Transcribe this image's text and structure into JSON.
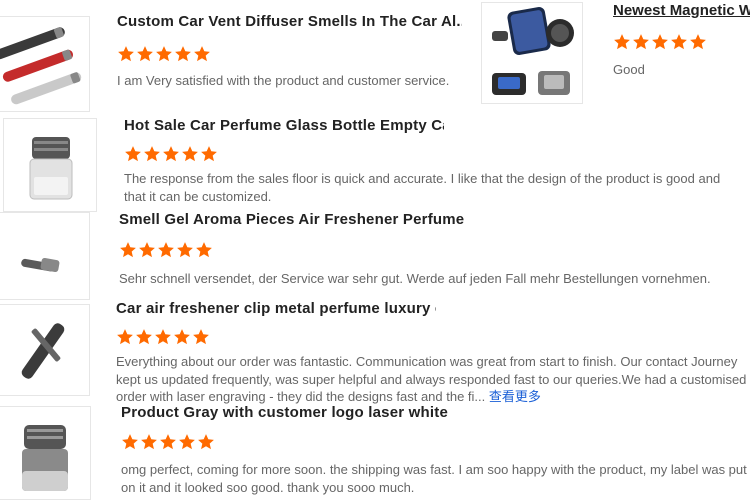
{
  "colors": {
    "star": "#ff6a00",
    "link": "#1a5fd6"
  },
  "products": [
    {
      "title": "Custom Car Vent Diffuser Smells In The Car Al...",
      "rating": 5,
      "review": "I am Very satisfied with the product and customer service.",
      "image": "car-vent-diffuser-sticks"
    },
    {
      "title": "Hot Sale Car Perfume Glass Bottle Empty Car ...",
      "rating": 5,
      "review": "The response from the sales floor is quick and accurate. I like that the design of the product is good and that it can be customized.",
      "image": "glass-perfume-bottle"
    },
    {
      "title": "Smell Gel Aroma Pieces Air Freshener Perfume...",
      "rating": 5,
      "review": "Sehr schnell versendet, der Service war sehr gut. Werde auf jeden Fall mehr Bestellungen vornehmen.",
      "image": "gel-vent-clip"
    },
    {
      "title": "Car air freshener clip metal perfume luxury cus...",
      "rating": 5,
      "review": "Everything about our order was fantastic. Communication was great from start to finish. Our contact Journey kept us updated frequently, was super helpful and always responded fast to our queries.We had a customised order with laser engraving - they did the designs fast and the fi...",
      "more_label": "查看更多",
      "image": "metal-clip-stick"
    },
    {
      "title": "Product Gray with customer logo laser white c...",
      "rating": 5,
      "review": "omg perfect, coming for more soon. the shipping was fast. I am soo happy with the product, my label was put on it and it looked soo good. thank you sooo much.",
      "image": "gray-vent-diffuser"
    }
  ],
  "side_product": {
    "title": "Newest Magnetic W",
    "rating": 5,
    "review": "Good",
    "image": "magnetic-phone-holder"
  }
}
